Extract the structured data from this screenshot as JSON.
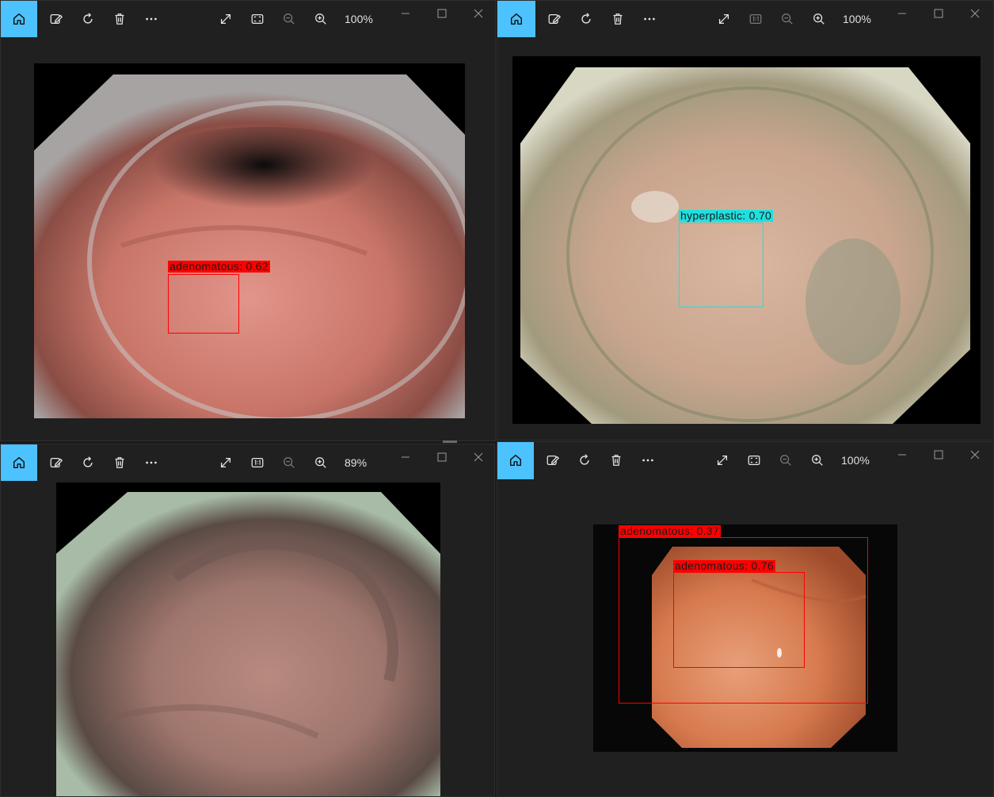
{
  "windows": [
    {
      "id": "top-left",
      "zoom": "100%",
      "detections": [
        {
          "label": "adenomatous: 0.62",
          "color": "#ff0000",
          "text_color": "#1a1a1a"
        }
      ]
    },
    {
      "id": "top-right",
      "zoom": "100%",
      "detections": [
        {
          "label": "hyperplastic: 0.70",
          "color": "#1fe0e0",
          "text_color": "#1a1a1a"
        }
      ]
    },
    {
      "id": "bottom-left",
      "zoom": "89%",
      "detections": []
    },
    {
      "id": "bottom-right",
      "zoom": "100%",
      "detections": [
        {
          "label": "adenomatous: 0.37",
          "color": "#ff0000",
          "text_color": "#1a1a1a"
        },
        {
          "label": "adenomatous: 0.76",
          "color": "#ff0000",
          "text_color": "#1a1a1a"
        }
      ]
    }
  ],
  "colors": {
    "accent": "#4cc2ff",
    "window_bg": "#202020"
  },
  "icons": {
    "home": "home-icon",
    "edit": "edit-image-icon",
    "rotate": "rotate-icon",
    "delete": "trash-icon",
    "more": "more-icon",
    "fullscreen": "expand-icon",
    "fit": "fit-to-window-icon",
    "actual_size": "actual-size-icon",
    "zoom_out": "zoom-out-icon",
    "zoom_in": "zoom-in-icon",
    "minimize": "minimize-icon",
    "maximize": "maximize-icon",
    "close": "close-icon"
  }
}
